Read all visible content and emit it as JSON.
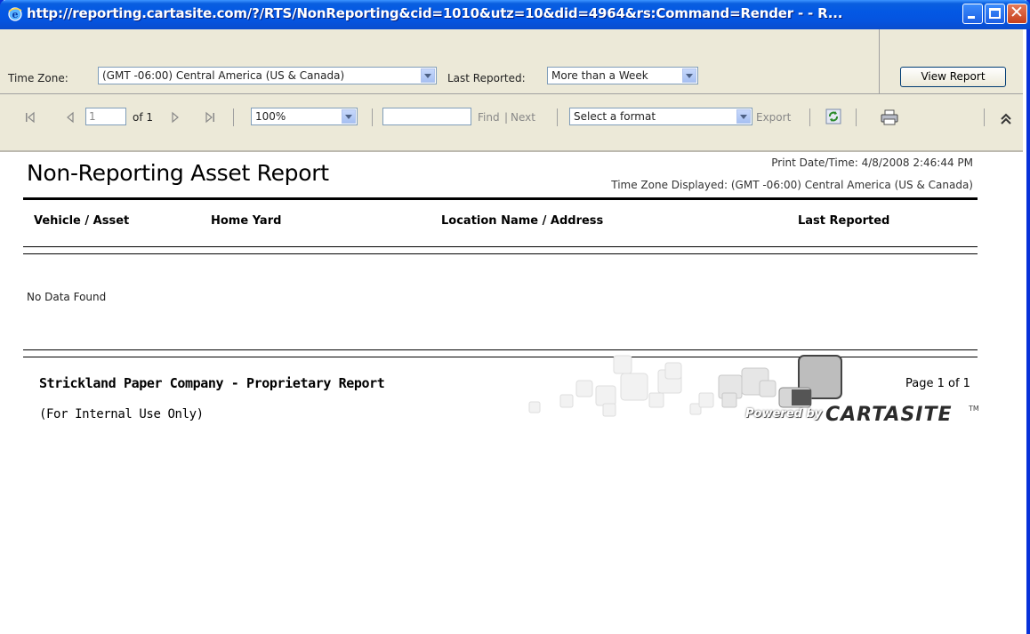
{
  "window": {
    "title": "http://reporting.cartasite.com/?/RTS/NonReporting&cid=1010&utz=10&did=4964&rs:Command=Render -  - R..."
  },
  "parameters": {
    "time_zone_label": "Time Zone:",
    "time_zone_value": "(GMT -06:00) Central America (US & Canada)",
    "last_reported_label": "Last Reported:",
    "last_reported_value": "More than a Week",
    "view_report_label": "View Report"
  },
  "toolbar": {
    "page_number": "1",
    "page_of": "of 1",
    "zoom_value": "100%",
    "find_value": "",
    "find_label": "Find",
    "find_separator": "|",
    "next_label": "Next",
    "format_value": "Select a format",
    "export_label": "Export"
  },
  "report": {
    "title": "Non-Reporting Asset Report",
    "print_datetime": "Print Date/Time: 4/8/2008 2:46:44 PM",
    "timezone_displayed": "Time Zone Displayed: (GMT -06:00) Central America (US & Canada)",
    "columns": [
      "Vehicle / Asset",
      "Home Yard",
      "Location Name / Address",
      "Last Reported"
    ],
    "no_data": "No Data Found",
    "footer_company": "Strickland Paper Company - Proprietary Report",
    "footer_internal": "(For Internal Use Only)",
    "page_info": "Page 1 of 1",
    "powered_by": "Powered by",
    "brand": "CARTASITE",
    "trademark": "TM"
  }
}
